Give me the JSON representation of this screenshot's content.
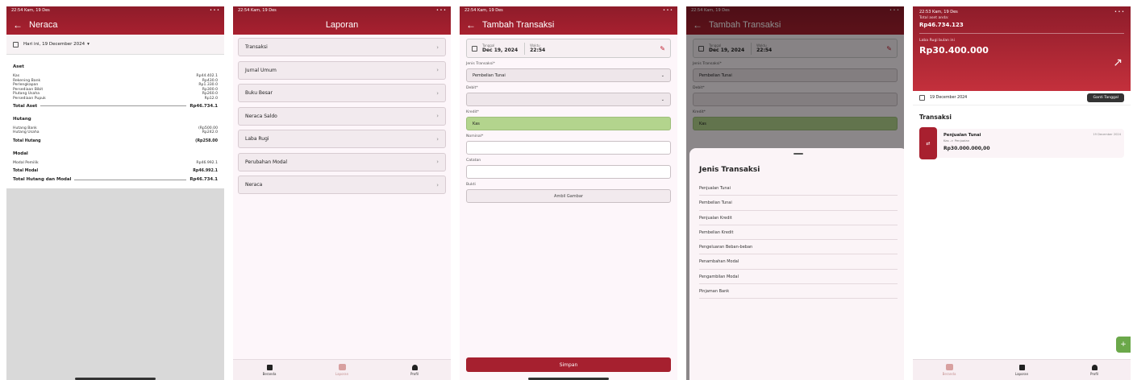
{
  "status": {
    "s1": "22:54 Kam, 19 Des",
    "s2": "22:54 Kam, 19 Des",
    "s3": "22:54 Kam, 19 Des",
    "s4": "22:54 Kam, 19 Des",
    "s5": "22:53 Kam, 19 Des"
  },
  "neraca": {
    "title": "Neraca",
    "date": "Hari ini, 19 December 2024",
    "aset_title": "Aset",
    "aset": [
      {
        "label": "Kas",
        "value": "Rp44.402.1"
      },
      {
        "label": "Rekening Bank",
        "value": "Rp430.0"
      },
      {
        "label": "Perlengkapan",
        "value": "Rp1.330.0"
      },
      {
        "label": "Persediaan Bibit",
        "value": "Rp300.0"
      },
      {
        "label": "Piutang Usaha",
        "value": "Rp260.0"
      },
      {
        "label": "Persediaan Pupuk",
        "value": "Rp12.0"
      }
    ],
    "total_aset_label": "Total Aset",
    "total_aset_value": "Rp46.734.1",
    "hutang_title": "Hutang",
    "hutang": [
      {
        "label": "Hutang Bank",
        "value": "(Rp500.00"
      },
      {
        "label": "Hutang Usaha",
        "value": "Rp242.0"
      }
    ],
    "total_hutang_label": "Total Hutang",
    "total_hutang_value": "(Rp258.00",
    "modal_title": "Modal",
    "modal": [
      {
        "label": "Modal Pemilik",
        "value": "Rp46.992.1"
      }
    ],
    "total_modal_label": "Total Modal",
    "total_modal_value": "Rp46.992.1",
    "grand_label": "Total Hutang dan Modal",
    "grand_value": "Rp46.734.1"
  },
  "laporan": {
    "title": "Laporan",
    "items": [
      "Transaksi",
      "Jurnal Umum",
      "Buku Besar",
      "Neraca Saldo",
      "Laba Rugi",
      "Perubahan Modal",
      "Neraca"
    ],
    "nav": [
      "Beranda",
      "Laporan",
      "Profil"
    ]
  },
  "tambah": {
    "title": "Tambah Transaksi",
    "tanggal_label": "Tanggal",
    "tanggal_value": "Dec 19, 2024",
    "waktu_label": "Waktu",
    "waktu_value": "22:54",
    "jenis_label": "Jenis Transaksi*",
    "jenis_value": "Pembelian Tunai",
    "debit_label": "Debit*",
    "kredit_label": "Kredit*",
    "kredit_value": "Kas",
    "nominal_label": "Nominal*",
    "catatan_label": "Catatan",
    "bukti_label": "Bukti",
    "ambil_label": "Ambil Gambar",
    "simpan_label": "Simpan"
  },
  "dialog": {
    "title": "Jenis Transaksi",
    "options": [
      "Penjualan Tunai",
      "Pembelian Tunai",
      "Penjualan Kredit",
      "Pembelian Kredit",
      "Pengeluaran Beban-beban",
      "Penambahan Modal",
      "Pengambilan Modal",
      "Pinjaman Bank"
    ]
  },
  "beranda": {
    "total_aset_label": "Total aset anda:",
    "total_aset_value": "Rp46.734.123",
    "laba_label": "Laba Rugi bulan ini",
    "laba_value": "Rp30.400.000",
    "date": "19 December 2024",
    "ganti_label": "Ganti Tanggal",
    "section": "Transaksi",
    "trx_name": "Penjualan Tunai",
    "trx_sub": "Kas -> Penjualan",
    "trx_amount": "Rp30.000.000,00",
    "trx_date": "19 December 2024",
    "nav": [
      "Beranda",
      "Laporan",
      "Profil"
    ]
  }
}
